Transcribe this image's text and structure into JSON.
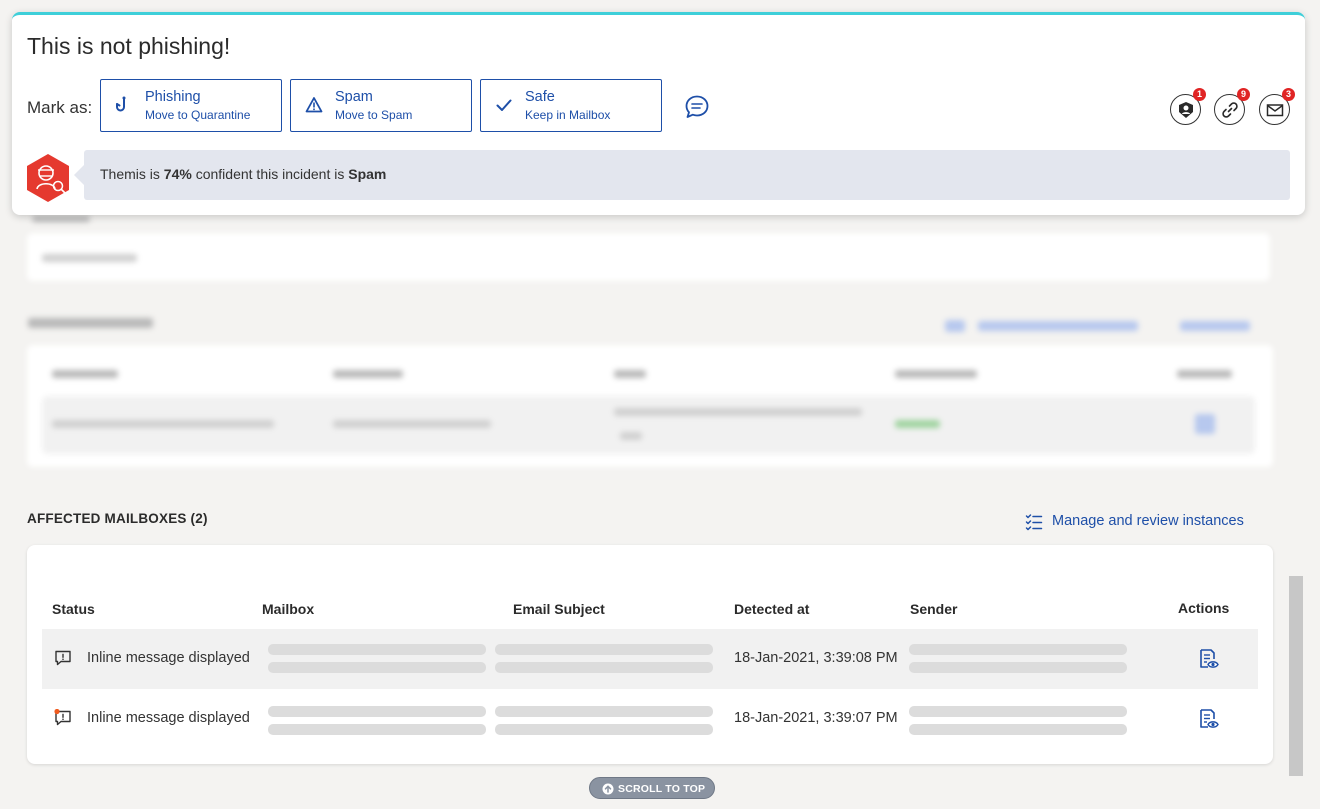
{
  "decision": {
    "title": "This is not phishing!",
    "mark_as_label": "Mark as:",
    "buttons": [
      {
        "title": "Phishing",
        "subtitle": "Move to Quarantine",
        "icon": "hook-icon"
      },
      {
        "title": "Spam",
        "subtitle": "Move to Spam",
        "icon": "warning-icon"
      },
      {
        "title": "Safe",
        "subtitle": "Keep in Mailbox",
        "icon": "check-icon"
      }
    ],
    "indicators": [
      {
        "icon": "user-icon",
        "count": "1"
      },
      {
        "icon": "link-icon",
        "count": "9"
      },
      {
        "icon": "mail-icon",
        "count": "3"
      }
    ]
  },
  "themis": {
    "prefix": "Themis is ",
    "confidence": "74%",
    "middle": " confident this incident is ",
    "verdict": "Spam"
  },
  "affected": {
    "title": "AFFECTED MAILBOXES (2)",
    "manage_link": "Manage and review instances",
    "columns": {
      "status": "Status",
      "mailbox": "Mailbox",
      "subject": "Email Subject",
      "detected": "Detected at",
      "sender": "Sender",
      "actions": "Actions"
    },
    "rows": [
      {
        "status": "Inline message displayed",
        "detected": "18-Jan-2021, 3:39:08 PM",
        "unread_dot": false
      },
      {
        "status": "Inline message displayed",
        "detected": "18-Jan-2021, 3:39:07 PM",
        "unread_dot": true
      }
    ]
  },
  "scroll_top": "SCROLL TO TOP",
  "colors": {
    "accent": "#1e4fa8",
    "card_top_border": "#3ecfd9",
    "badge": "#e02424",
    "themis_red": "#e5392f"
  }
}
